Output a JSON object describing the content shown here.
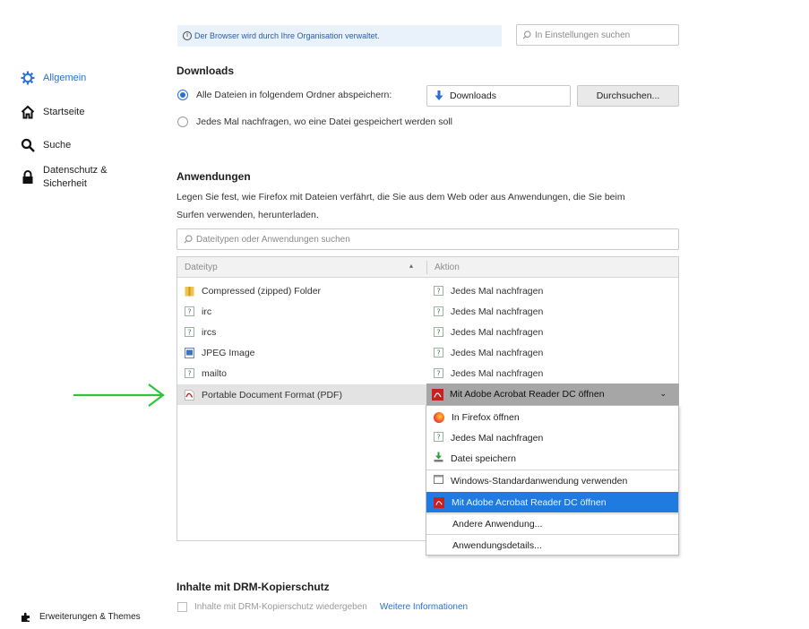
{
  "notice": {
    "text": "Der Browser wird durch Ihre Organisation verwaltet."
  },
  "search": {
    "placeholder": "In Einstellungen suchen"
  },
  "sidebar": {
    "items": [
      {
        "label": "Allgemein",
        "icon": "gear-icon",
        "active": true
      },
      {
        "label": "Startseite",
        "icon": "home-icon"
      },
      {
        "label": "Suche",
        "icon": "search-icon"
      },
      {
        "label": "Datenschutz &",
        "label2": "Sicherheit",
        "icon": "lock-icon"
      }
    ],
    "footer": {
      "label": "Erweiterungen & Themes",
      "icon": "puzzle-icon"
    }
  },
  "downloads": {
    "title": "Downloads",
    "option_folder": "Alle Dateien in folgendem Ordner abspeichern:",
    "folder_value": "Downloads",
    "browse_label": "Durchsuchen...",
    "option_ask": "Jedes Mal nachfragen, wo eine Datei gespeichert werden soll"
  },
  "applications": {
    "title": "Anwendungen",
    "desc1": "Legen Sie fest, wie Firefox mit Dateien verfährt, die Sie aus dem Web oder aus Anwendungen, die Sie beim",
    "desc2": "Surfen verwenden, herunterladen.",
    "filter_placeholder": "Dateitypen oder Anwendungen suchen",
    "col_type": "Dateityp",
    "col_action": "Aktion",
    "rows": [
      {
        "type": "Compressed (zipped) Folder",
        "icon": "zip-folder-icon",
        "action": "Jedes Mal nachfragen"
      },
      {
        "type": "irc",
        "icon": "generic-file-icon",
        "action": "Jedes Mal nachfragen"
      },
      {
        "type": "ircs",
        "icon": "generic-file-icon",
        "action": "Jedes Mal nachfragen"
      },
      {
        "type": "JPEG Image",
        "icon": "image-file-icon",
        "action": "Jedes Mal nachfragen"
      },
      {
        "type": "mailto",
        "icon": "generic-file-icon",
        "action": "Jedes Mal nachfragen"
      },
      {
        "type": "Portable Document Format (PDF)",
        "icon": "pdf-file-icon",
        "action": "Mit Adobe Acrobat Reader DC  öffnen"
      }
    ],
    "menu": [
      {
        "label": "In Firefox öffnen",
        "icon": "firefox-icon"
      },
      {
        "label": "Jedes Mal nachfragen",
        "icon": "ask-icon"
      },
      {
        "label": "Datei speichern",
        "icon": "save-icon"
      },
      {
        "label": "Windows-Standardanwendung verwenden",
        "icon": "window-icon"
      },
      {
        "label": "Mit Adobe Acrobat Reader DC  öffnen",
        "icon": "acrobat-icon"
      },
      {
        "label": "Andere Anwendung...",
        "icon": ""
      },
      {
        "label": "Anwendungsdetails...",
        "icon": ""
      }
    ]
  },
  "drm": {
    "title": "Inhalte mit DRM-Kopierschutz",
    "checkbox_label": "Inhalte mit DRM-Kopierschutz wiedergeben",
    "link": "Weitere Informationen"
  },
  "colors": {
    "accent": "#2a6fd6",
    "highlight": "#1f7be0",
    "arrow": "#2fc33a",
    "pdf_red": "#c8201e"
  }
}
